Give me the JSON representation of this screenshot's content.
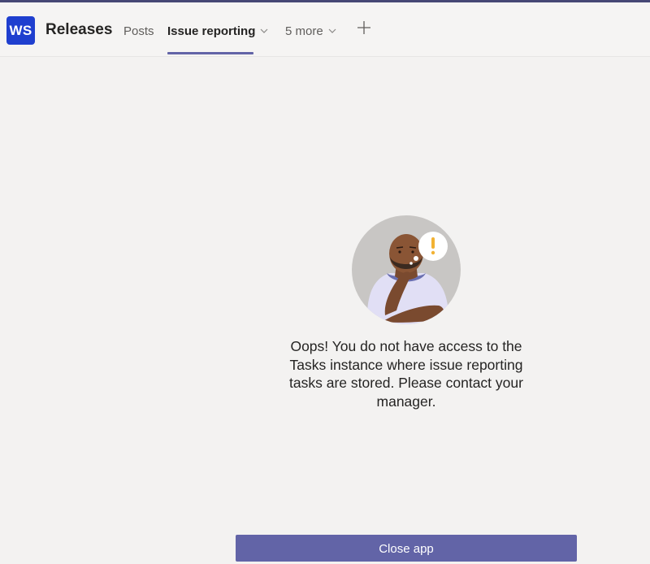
{
  "header": {
    "team_avatar_initials": "WS",
    "team_name": "Releases",
    "tabs": [
      {
        "label": "Posts",
        "active": false
      },
      {
        "label": "Issue reporting",
        "active": true,
        "has_dropdown": true
      },
      {
        "label": "5 more",
        "active": false,
        "has_dropdown": true
      }
    ],
    "add_tab_icon": "plus-icon",
    "accent_color": "#6264a7",
    "avatar_color": "#1f3fcf"
  },
  "main": {
    "illustration": "person-thinking-with-exclamation",
    "message": "Oops! You do not have access to the Tasks instance where issue reporting tasks are stored. Please contact your manager.",
    "message_lines": [
      "Oops! You do not have access to the",
      "Tasks instance where issue reporting",
      "tasks are stored. Please contact your",
      "manager."
    ],
    "close_button_label": "Close app"
  }
}
